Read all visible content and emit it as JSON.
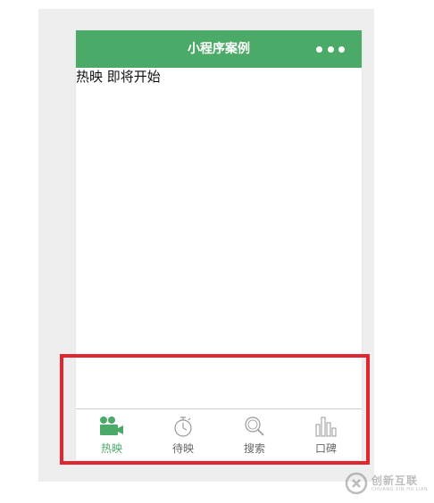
{
  "navbar": {
    "title": "小程序案例",
    "background": "#4caa68",
    "more_icon": "more-dots-icon"
  },
  "content": {
    "text": "热映 即将开始"
  },
  "tabbar": {
    "active_color": "#4caa68",
    "inactive_color": "#999999",
    "items": [
      {
        "label": "热映",
        "icon": "camera-icon",
        "active": true
      },
      {
        "label": "待映",
        "icon": "stopwatch-icon",
        "active": false
      },
      {
        "label": "搜索",
        "icon": "search-icon",
        "active": false
      },
      {
        "label": "口碑",
        "icon": "bar-chart-icon",
        "active": false
      }
    ]
  },
  "annotation": {
    "color": "#e2262f"
  },
  "watermark": {
    "main": "创新互联",
    "sub": "CHUANG XIN HU LIAN"
  }
}
